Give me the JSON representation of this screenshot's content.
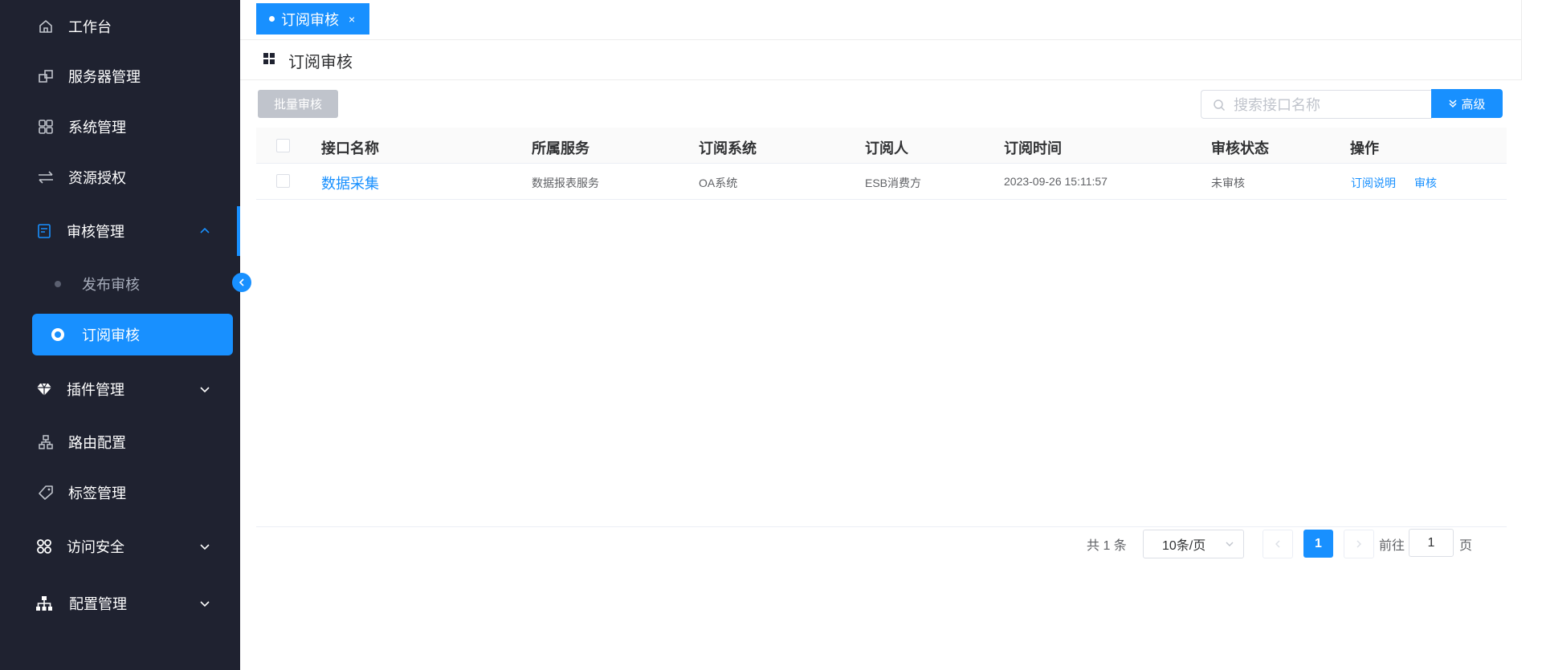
{
  "sidebar": {
    "items": [
      {
        "label": "工作台",
        "icon": "home-icon"
      },
      {
        "label": "服务器管理",
        "icon": "server-icon"
      },
      {
        "label": "系统管理",
        "icon": "grid-icon"
      },
      {
        "label": "资源授权",
        "icon": "transfer-icon"
      },
      {
        "label": "审核管理",
        "icon": "audit-icon",
        "expanded": true,
        "children": [
          {
            "label": "发布审核",
            "active": false
          },
          {
            "label": "订阅审核",
            "active": true
          }
        ]
      },
      {
        "label": "插件管理",
        "icon": "diamond-icon"
      },
      {
        "label": "路由配置",
        "icon": "route-icon"
      },
      {
        "label": "标签管理",
        "icon": "tag-icon"
      },
      {
        "label": "访问安全",
        "icon": "apps-icon"
      },
      {
        "label": "配置管理",
        "icon": "hierarchy-icon"
      }
    ]
  },
  "tabs": [
    {
      "label": "订阅审核",
      "close": "×"
    }
  ],
  "page": {
    "title": "订阅审核"
  },
  "toolbar": {
    "batch_label": "批量审核",
    "search_placeholder": "搜索接口名称",
    "advanced_label": "高级"
  },
  "table": {
    "columns": [
      "接口名称",
      "所属服务",
      "订阅系统",
      "订阅人",
      "订阅时间",
      "审核状态",
      "操作"
    ],
    "rows": [
      {
        "name": "数据采集",
        "service": "数据报表服务",
        "system": "OA系统",
        "subscriber": "ESB消费方",
        "time": "2023-09-26 15:11:57",
        "status": "未审核",
        "actions": [
          "订阅说明",
          "审核"
        ]
      }
    ]
  },
  "pagination": {
    "total_text": "共 1 条",
    "page_size": "10条/页",
    "current_page": "1",
    "goto_label": "前往",
    "goto_value": "1",
    "page_unit": "页"
  },
  "colors": {
    "sidebar_bg": "#1f2230",
    "accent": "#1890ff",
    "disabled_button": "#c0c4cc"
  }
}
